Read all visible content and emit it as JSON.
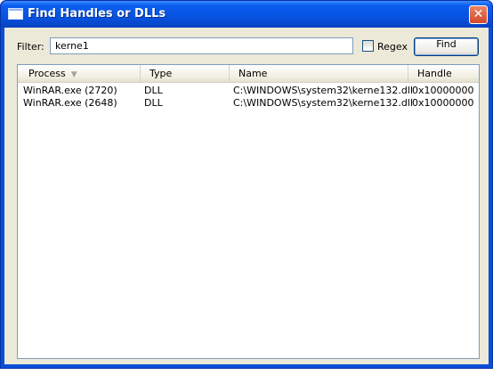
{
  "window": {
    "title": "Find Handles or DLLs",
    "close_glyph": "✕"
  },
  "filter": {
    "label": "Filter:",
    "value": "kerne1"
  },
  "regex": {
    "label": "Regex",
    "checked": false
  },
  "find_button": {
    "label": "Find"
  },
  "table": {
    "columns": [
      "Process",
      "Type",
      "Name",
      "Handle"
    ],
    "sort_indicator": "▼",
    "rows": [
      {
        "process": "WinRAR.exe (2720)",
        "type": "DLL",
        "name": "C:\\WINDOWS\\system32\\kerne132.dll",
        "handle": "0x10000000"
      },
      {
        "process": "WinRAR.exe (2648)",
        "type": "DLL",
        "name": "C:\\WINDOWS\\system32\\kerne132.dll",
        "handle": "0x10000000"
      }
    ]
  },
  "colors": {
    "titlebar": "#0a5cf0",
    "dialog_face": "#ece9d8",
    "close_button": "#d2492b"
  }
}
